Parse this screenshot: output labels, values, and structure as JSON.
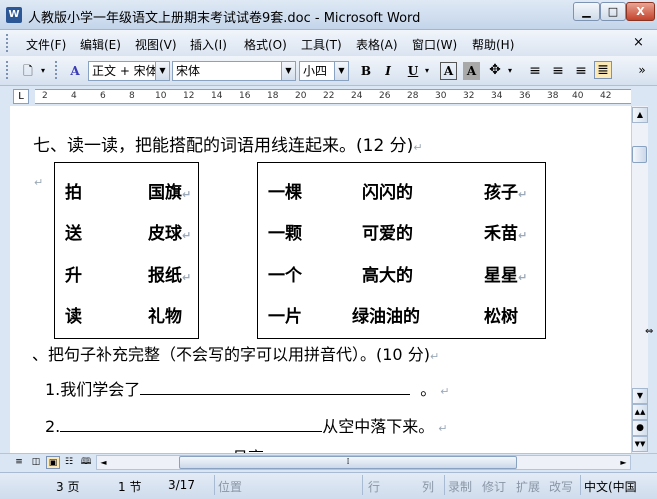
{
  "window": {
    "title": "人教版小学一年级语文上册期末考试试卷9套.doc - Microsoft Word",
    "app_icon": "W",
    "controls": {
      "minimize": "▁",
      "maximize": "□",
      "close": "X"
    }
  },
  "menu": {
    "items": [
      "文件(F)",
      "编辑(E)",
      "视图(V)",
      "插入(I)",
      "格式(O)",
      "工具(T)",
      "表格(A)",
      "窗口(W)",
      "帮助(H)"
    ],
    "close_doc": "×"
  },
  "toolbar": {
    "new_doc": "🗋",
    "style_icon": "A",
    "style_value": "正文 + 宋体",
    "font_value": "宋体",
    "size_value": "小四",
    "bold": "B",
    "italic": "I",
    "underline": "U",
    "char_border": "A",
    "char_shading": "A",
    "more": "»"
  },
  "ruler": {
    "corner": "L",
    "ticks": [
      "2",
      "4",
      "6",
      "8",
      "10",
      "12",
      "14",
      "16",
      "18",
      "20",
      "22",
      "24",
      "26",
      "28",
      "30",
      "32",
      "34",
      "36",
      "38",
      "40",
      "42"
    ]
  },
  "document": {
    "section7_heading": "七、读一读，把能搭配的词语用线连起来。(12 分)",
    "table1": {
      "left": [
        "拍",
        "送",
        "升",
        "读"
      ],
      "right": [
        "国旗",
        "皮球",
        "报纸",
        "礼物"
      ]
    },
    "table2": {
      "col1": [
        "一棵",
        "一颗",
        "一个",
        "一片"
      ],
      "col2": [
        "闪闪的",
        "可爱的",
        "高大的",
        "绿油油的"
      ],
      "col3": [
        "孩子",
        "禾苗",
        "星星",
        "松树"
      ]
    },
    "section8_heading": "、把句子补充完整（不会写的字可以用拼音代）。(10 分)",
    "q1_prefix": "1.我们学会了",
    "q1_suffix": "。",
    "q2_prefix": "2.",
    "q2_suffix": "从空中落下来。",
    "q3_partial": "月亮"
  },
  "status": {
    "page": "3 页",
    "section": "1 节",
    "page_of": "3/17",
    "position": "位置",
    "line": "行",
    "column": "列",
    "rec": "录制",
    "trk": "修订",
    "ext": "扩展",
    "ovr": "改写",
    "language": "中文(中国"
  }
}
